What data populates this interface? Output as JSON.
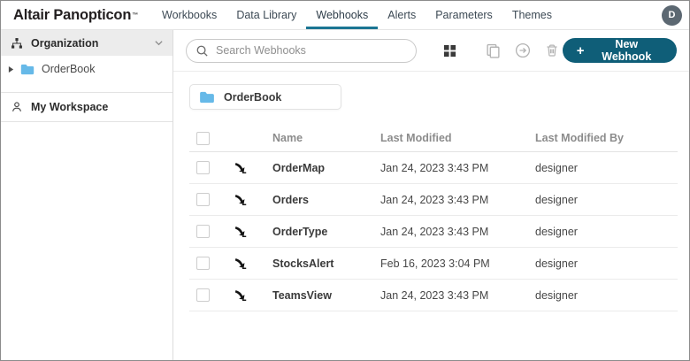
{
  "header": {
    "logo": "Altair Panopticon",
    "logo_trademark": "™",
    "tabs": [
      {
        "label": "Workbooks"
      },
      {
        "label": "Data Library"
      },
      {
        "label": "Webhooks"
      },
      {
        "label": "Alerts"
      },
      {
        "label": "Parameters"
      },
      {
        "label": "Themes"
      }
    ],
    "active_tab": "Webhooks",
    "avatar_initial": "D"
  },
  "sidebar": {
    "organization": {
      "label": "Organization"
    },
    "folders": [
      {
        "label": "OrderBook"
      }
    ],
    "my_workspace": {
      "label": "My Workspace"
    }
  },
  "toolbar": {
    "search": {
      "placeholder": "Search Webhooks"
    },
    "icons": [
      "grid-view-icon",
      "copy-icon",
      "move-icon",
      "delete-icon"
    ],
    "new_webhook_button": {
      "plus": "+",
      "label": "New Webhook"
    }
  },
  "content": {
    "folder_card": {
      "label": "OrderBook"
    },
    "table": {
      "columns": [
        "Name",
        "Last Modified",
        "Last Modified By"
      ],
      "rows": [
        {
          "name": "OrderMap",
          "last_modified": "Jan 24, 2023 3:43 PM",
          "last_modified_by": "designer"
        },
        {
          "name": "Orders",
          "last_modified": "Jan 24, 2023 3:43 PM",
          "last_modified_by": "designer"
        },
        {
          "name": "OrderType",
          "last_modified": "Jan 24, 2023 3:43 PM",
          "last_modified_by": "designer"
        },
        {
          "name": "StocksAlert",
          "last_modified": "Feb 16, 2023 3:04 PM",
          "last_modified_by": "designer"
        },
        {
          "name": "TeamsView",
          "last_modified": "Jan 24, 2023 3:43 PM",
          "last_modified_by": "designer"
        }
      ]
    }
  },
  "colors": {
    "accent_teal": "#1b7593",
    "button_teal": "#0f5e78",
    "folder_blue": "#66b9e8",
    "avatar_gray": "#5c6872"
  }
}
